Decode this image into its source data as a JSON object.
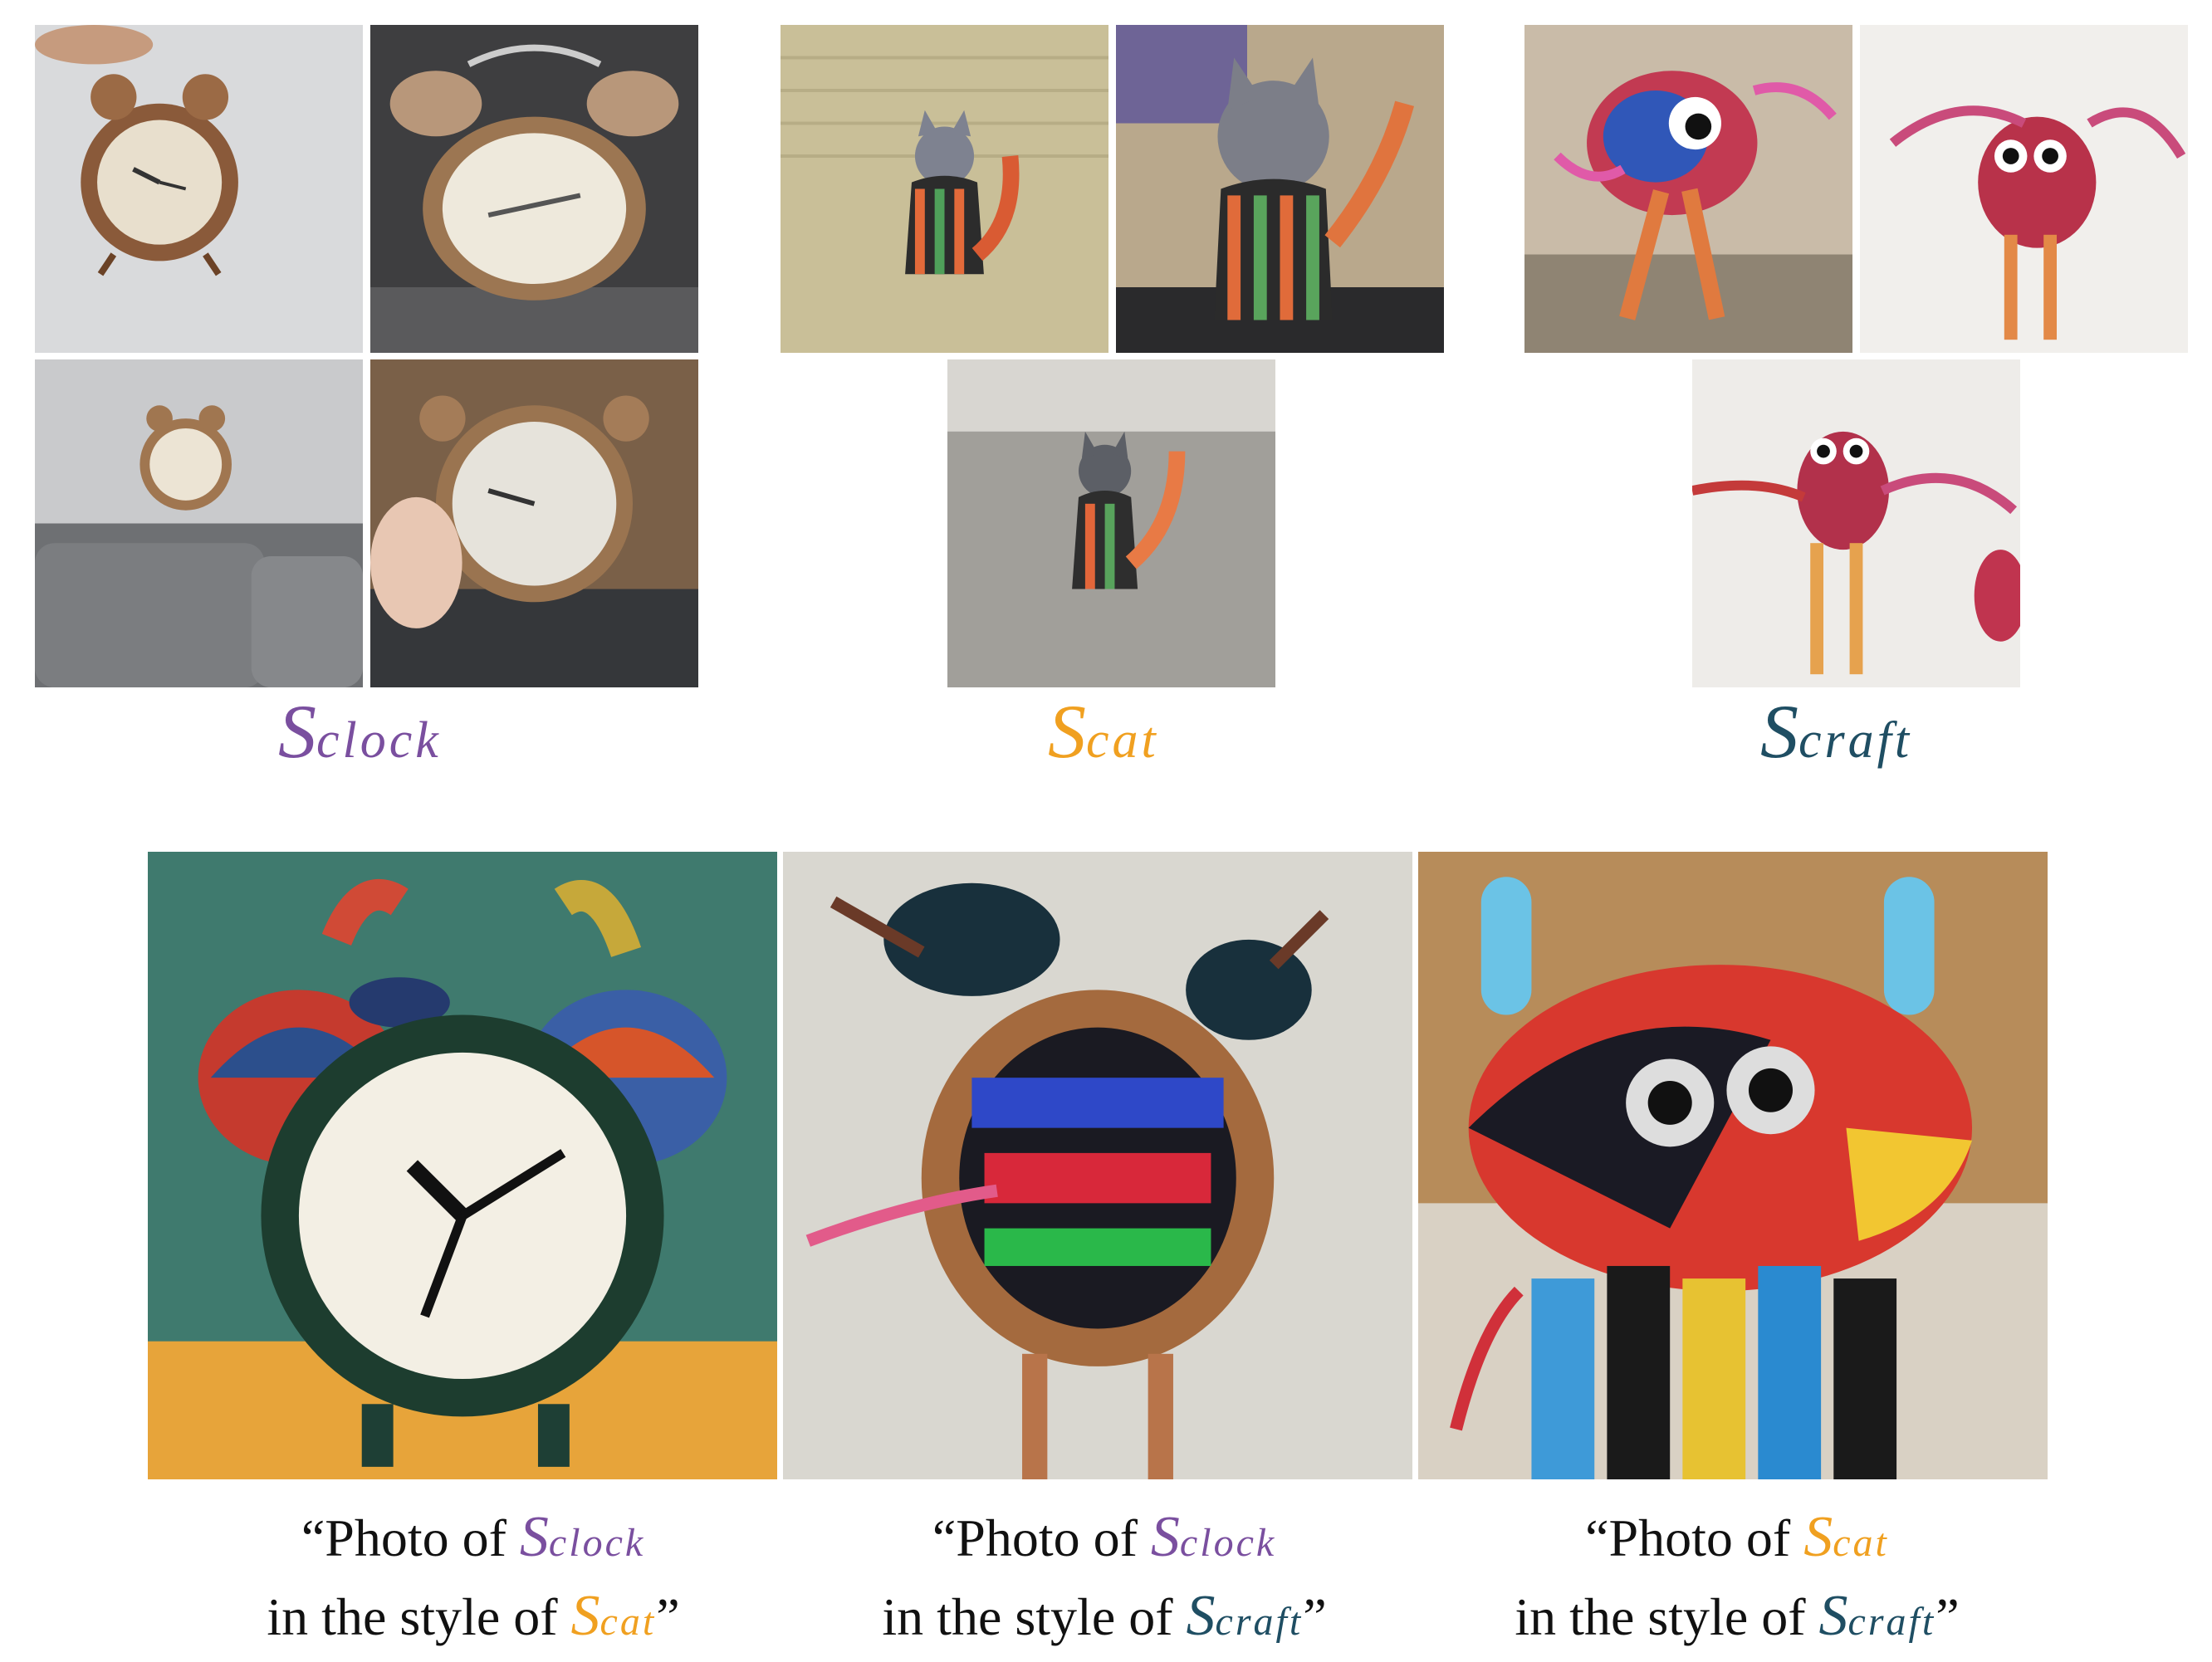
{
  "colors": {
    "clock": "#7a4f9f",
    "cat": "#f0a020",
    "craft": "#1f4e63"
  },
  "concepts": [
    {
      "key": "clock",
      "prefix": "S",
      "subscript": "clock"
    },
    {
      "key": "cat",
      "prefix": "S",
      "subscript": "cat"
    },
    {
      "key": "craft",
      "prefix": "S",
      "subscript": "craft"
    }
  ],
  "captions": [
    {
      "open": "“Photo of ",
      "t1_prefix": "S",
      "t1_sub": "clock",
      "line2": "in the style of ",
      "t2_prefix": "S",
      "t2_sub": "cat",
      "close": "”"
    },
    {
      "open": "“Photo of ",
      "t1_prefix": "S",
      "t1_sub": "clock",
      "line2": "in the style of ",
      "t2_prefix": "S",
      "t2_sub": "craft",
      "close": "”"
    },
    {
      "open": "“Photo of ",
      "t1_prefix": "S",
      "t1_sub": "cat",
      "line2": "in the style of ",
      "t2_prefix": "S",
      "t2_sub": "craft",
      "close": "”"
    }
  ]
}
